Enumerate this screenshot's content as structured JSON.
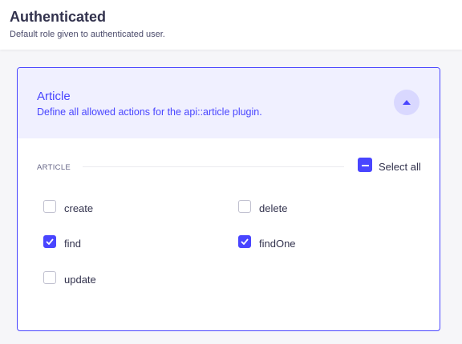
{
  "page": {
    "title": "Authenticated",
    "subtitle": "Default role given to authenticated user."
  },
  "card": {
    "title": "Article",
    "description": "Define all allowed actions for the api::article plugin.",
    "expanded": true,
    "collapse_icon": "chevron-up-icon"
  },
  "section": {
    "label": "ARTICLE",
    "select_all_label": "Select all",
    "select_all_state": "indeterminate"
  },
  "actions": [
    {
      "label": "create",
      "checked": false
    },
    {
      "label": "delete",
      "checked": false
    },
    {
      "label": "find",
      "checked": true
    },
    {
      "label": "findOne",
      "checked": true
    },
    {
      "label": "update",
      "checked": false
    }
  ],
  "colors": {
    "primary": "#4945ff",
    "header_bg": "#f0f0ff",
    "page_bg": "#f6f6f9"
  }
}
